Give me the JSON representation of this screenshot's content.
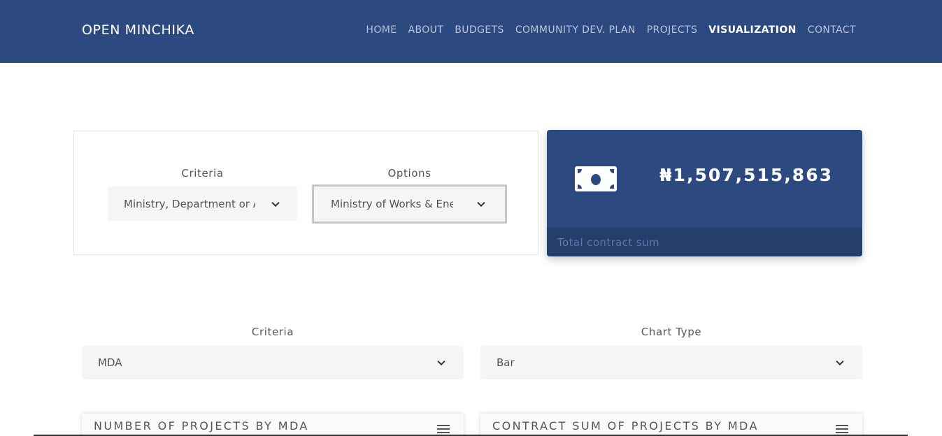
{
  "nav": {
    "brand": "OPEN MINCHIKA",
    "links": [
      "HOME",
      "ABOUT",
      "BUDGETS",
      "COMMUNITY DEV. PLAN",
      "PROJECTS",
      "VISUALIZATION",
      "CONTACT"
    ],
    "active": "VISUALIZATION"
  },
  "filter": {
    "criteria_label": "Criteria",
    "criteria_value": "Ministry, Department or Agency",
    "options_label": "Options",
    "options_value": "Ministry of Works & Energy"
  },
  "stat": {
    "icon": "money-bill-icon",
    "amount": "₦1,507,515,863",
    "caption": "Total contract sum"
  },
  "chart_controls": {
    "criteria_label": "Criteria",
    "criteria_value": "MDA",
    "chart_type_label": "Chart Type",
    "chart_type_value": "Bar"
  },
  "panels": {
    "left_title": "NUMBER OF PROJECTS BY MDA",
    "right_title": "CONTRACT SUM OF PROJECTS BY MDA"
  },
  "colors": {
    "brand": "#2c4a80",
    "footer": "#253f6d"
  }
}
